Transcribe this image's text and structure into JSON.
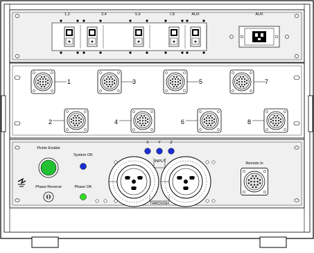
{
  "breakers": {
    "labels": [
      "1,2",
      "3,4",
      "5,6",
      "7,8",
      "AUX"
    ]
  },
  "aux_panel": {
    "label": "AUX"
  },
  "connectors": {
    "row1": [
      "1",
      "3",
      "5",
      "7"
    ],
    "row2": [
      "2",
      "4",
      "6",
      "8"
    ]
  },
  "controls": {
    "pickle_enable": "Pickle Enable",
    "system_ok": "System OK",
    "phase_reverse": "Phase Reverse",
    "phase_ok": "Phase OK",
    "remote_in": "Remote In"
  },
  "phase_inputs": {
    "labels": [
      "X",
      "Y",
      "Z"
    ],
    "input": "INPUT",
    "through": "THROUGH"
  },
  "colors": {
    "pickle_button": "#22c033",
    "system_ok_led": "#1a2fd6",
    "phase_ok_led": "#33dd22",
    "input_leds": "#1a2fd6",
    "panel_gray": "#f0f0f0"
  }
}
